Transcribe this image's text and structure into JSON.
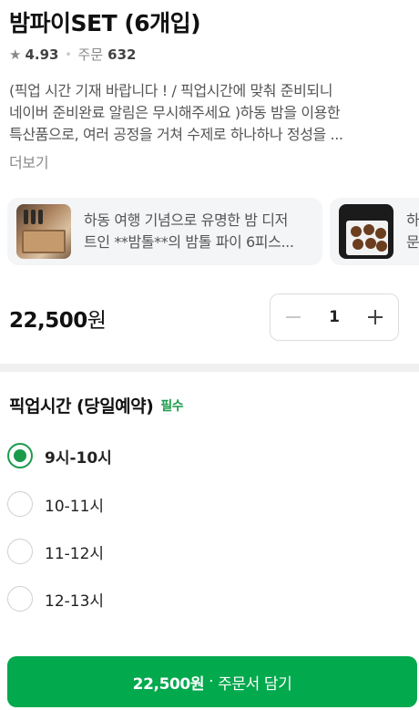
{
  "product": {
    "title": "밤파이SET (6개입)",
    "rating": "4.93",
    "order_label": "주문",
    "order_count": "632",
    "description_lines": [
      "(픽업 시간 기재 바랍니다 ! / 픽업시간에 맞춰 준비되니",
      "네이버 준비완료 알림은 무시해주세요 )하동 밤을 이용한",
      "특산품으로, 여러 공정을 거쳐 수제로 하나하나 정성을 ..."
    ],
    "more_label": "더보기"
  },
  "reviews": [
    {
      "line1": "하동 여행 기념으로 유명한 밤 디저",
      "line2": "트인 **밤톨**의 밤톨 파이 6피스..."
    },
    {
      "line1": "하",
      "line2": "문"
    }
  ],
  "purchase": {
    "price": "22,500",
    "currency": "원",
    "quantity": "1"
  },
  "pickup": {
    "title": "픽업시간 (당일예약)",
    "required_label": "필수",
    "options": [
      {
        "label": "9시-10시",
        "selected": true
      },
      {
        "label": "10-11시",
        "selected": false
      },
      {
        "label": "11-12시",
        "selected": false
      },
      {
        "label": "12-13시",
        "selected": false
      }
    ]
  },
  "cta": {
    "amount": "22,500원",
    "separator": "·",
    "action": "주문서 담기"
  },
  "colors": {
    "accent": "#03a94d",
    "required": "#1a9b4b"
  },
  "icons": [
    "star-icon",
    "minus-icon",
    "plus-icon",
    "radio-icon"
  ]
}
